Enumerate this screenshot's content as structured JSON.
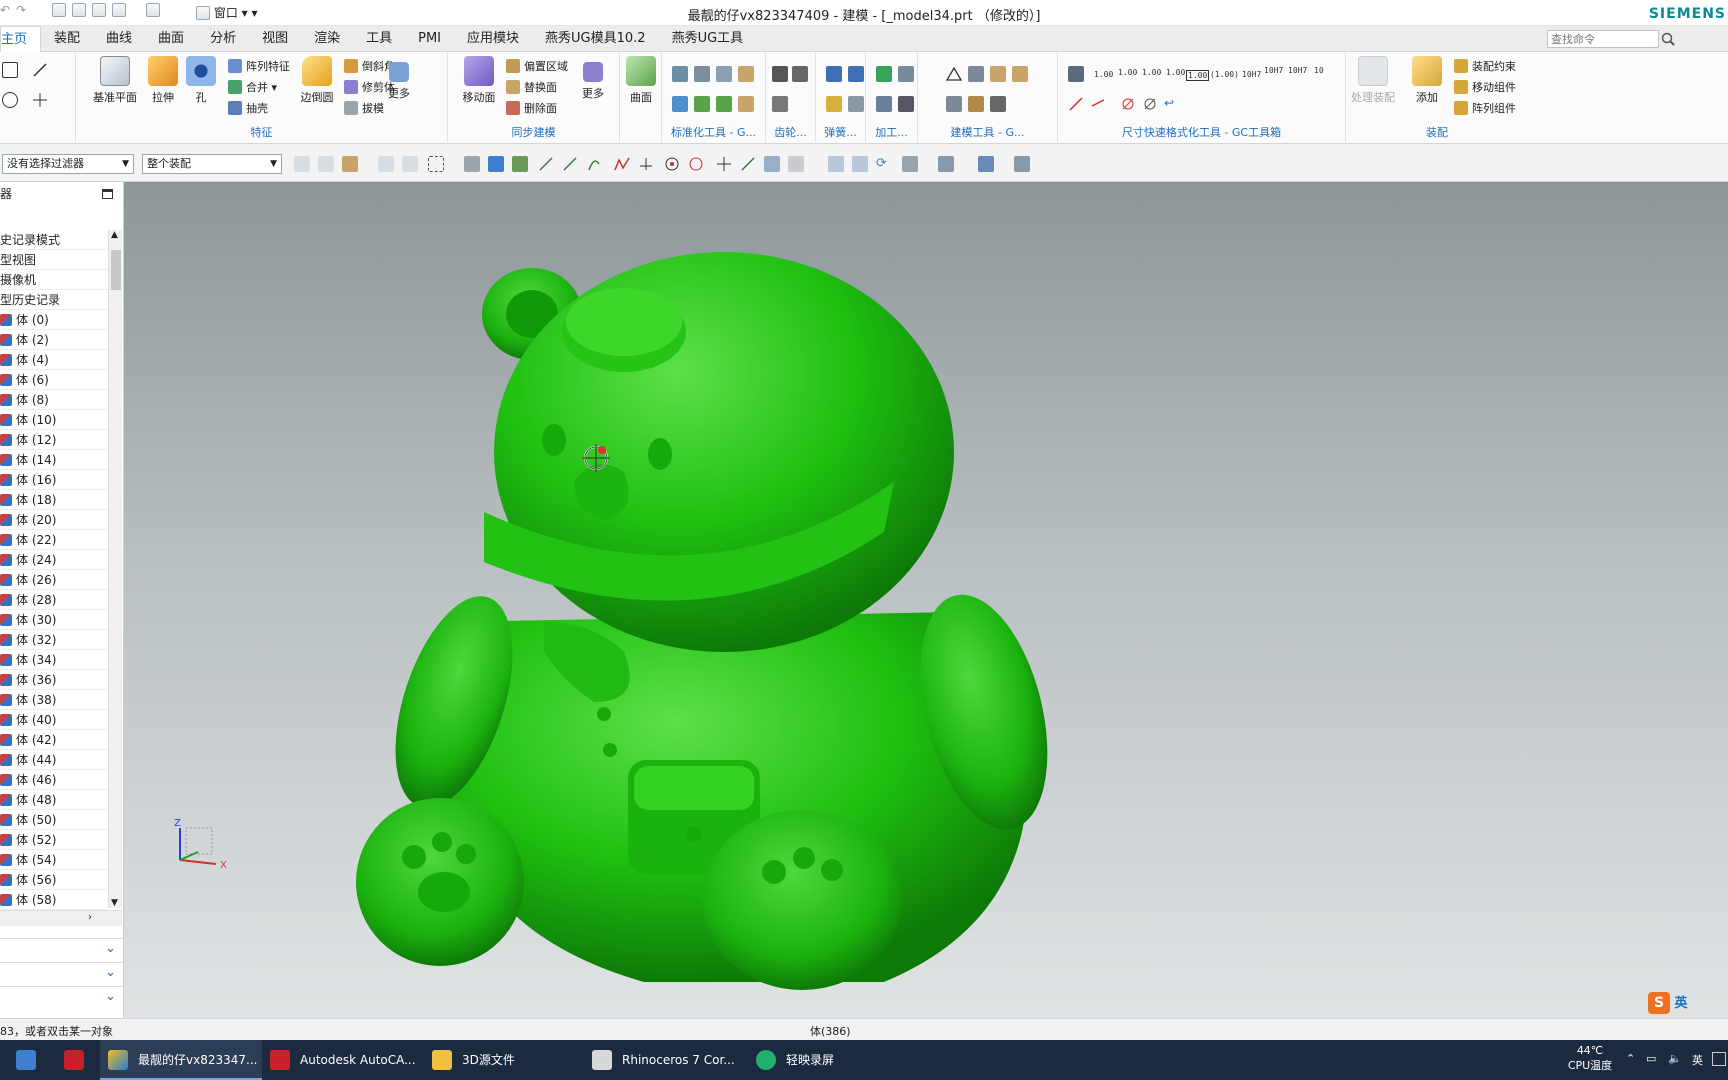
{
  "window": {
    "title": "最靓的仔vx823347409 - 建模 - [_model34.prt （修改的）]",
    "window_menu": "窗口",
    "brand": "SIEMENS"
  },
  "tabs": [
    "主页",
    "装配",
    "曲线",
    "曲面",
    "分析",
    "视图",
    "渲染",
    "工具",
    "PMI",
    "应用模块",
    "燕秀UG模具10.2",
    "燕秀UG工具"
  ],
  "active_tab": "主页",
  "command_search": {
    "placeholder": "查找命令"
  },
  "ribbon": {
    "feature": {
      "label": "特征",
      "datum_plane": "基准平面",
      "extrude": "拉伸",
      "hole": "孔",
      "pattern_feature": "阵列特征",
      "unite": "合并",
      "shell": "抽壳",
      "edge_blend": "边倒圆",
      "chamfer": "倒斜角",
      "trim_body": "修剪体",
      "draft": "拔模",
      "more": "更多"
    },
    "sync": {
      "label": "同步建模",
      "move_face": "移动面",
      "offset_region": "偏置区域",
      "replace_face": "替换面",
      "delete_face": "删除面",
      "more": "更多"
    },
    "surface": {
      "label": "曲面"
    },
    "standard_tools": {
      "label": "标准化工具 - G..."
    },
    "gear": {
      "label": "齿轮..."
    },
    "spring": {
      "label": "弹簧..."
    },
    "machining": {
      "label": "加工..."
    },
    "modeling_tools": {
      "label": "建模工具 - G..."
    },
    "dim_format": {
      "label": "尺寸快速格式化工具 - GC工具箱",
      "dims": [
        "1.00",
        "1.00",
        "1.00",
        "1.00",
        "1.00",
        "(1.00)",
        "10H7",
        "10H7",
        "10H7",
        "10"
      ]
    },
    "assembly": {
      "label": "装配",
      "process_assembly": "处理装配",
      "add": "添加",
      "assembly_constraints": "装配约束",
      "move_component": "移动组件",
      "pattern_component": "阵列组件"
    }
  },
  "filterbar": {
    "selection_filter": "没有选择过滤器",
    "scope": "整个装配"
  },
  "navigator": {
    "title": "器",
    "rows": [
      "史记录模式",
      "型视图",
      "摄像机",
      "型历史记录"
    ],
    "bodies": [
      "体 (0)",
      "体 (2)",
      "体 (4)",
      "体 (6)",
      "体 (8)",
      "体 (10)",
      "体 (12)",
      "体 (14)",
      "体 (16)",
      "体 (18)",
      "体 (20)",
      "体 (22)",
      "体 (24)",
      "体 (26)",
      "体 (28)",
      "体 (30)",
      "体 (32)",
      "体 (34)",
      "体 (36)",
      "体 (38)",
      "体 (40)",
      "体 (42)",
      "体 (44)",
      "体 (46)",
      "体 (48)",
      "体 (50)",
      "体 (52)",
      "体 (54)",
      "体 (56)",
      "体 (58)"
    ]
  },
  "viewport": {
    "model_color": "#1fbf10",
    "background_top": "#8d9699",
    "background_bottom": "#dfe3e4",
    "triad": {
      "x": "X",
      "z": "Z"
    }
  },
  "status": {
    "prompt": "83，或者双击某一对象",
    "selection": "体(386)"
  },
  "ime": {
    "label": "英"
  },
  "taskbar": {
    "items": [
      {
        "label": "",
        "icon": "windows-start-icon"
      },
      {
        "label": "",
        "icon": "solidworks-2021-icon"
      },
      {
        "label": "最靓的仔vx823347...",
        "icon": "nx-icon"
      },
      {
        "label": "Autodesk AutoCA...",
        "icon": "autocad-icon"
      },
      {
        "label": "3D源文件",
        "icon": "folder-icon"
      },
      {
        "label": "Rhinoceros 7 Cor...",
        "icon": "rhino-icon"
      },
      {
        "label": "轻映录屏",
        "icon": "recorder-icon"
      }
    ],
    "temperature": "44℃",
    "cpu_label": "CPU温度",
    "lang": "英"
  }
}
